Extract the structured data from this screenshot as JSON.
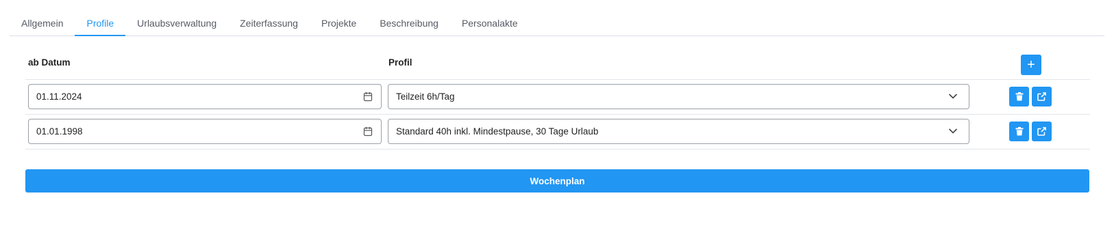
{
  "tabs": [
    {
      "label": "Allgemein",
      "active": false
    },
    {
      "label": "Profile",
      "active": true
    },
    {
      "label": "Urlaubsverwaltung",
      "active": false
    },
    {
      "label": "Zeiterfassung",
      "active": false
    },
    {
      "label": "Projekte",
      "active": false
    },
    {
      "label": "Beschreibung",
      "active": false
    },
    {
      "label": "Personalakte",
      "active": false
    }
  ],
  "table": {
    "headers": {
      "date": "ab Datum",
      "profile": "Profil"
    },
    "add_label": "+",
    "rows": [
      {
        "date": "01.11.2024",
        "profile": "Teilzeit 6h/Tag"
      },
      {
        "date": "01.01.1998",
        "profile": "Standard 40h inkl. Mindestpause, 30 Tage Urlaub"
      }
    ]
  },
  "wochenplan_label": "Wochenplan",
  "colors": {
    "accent": "#2196f3",
    "border": "#9aa0a6",
    "divider": "#e2e5e9"
  },
  "icons": {
    "date": "calendar-icon",
    "select": "chevron-down-icon",
    "delete": "trash-icon",
    "open": "external-link-icon"
  }
}
